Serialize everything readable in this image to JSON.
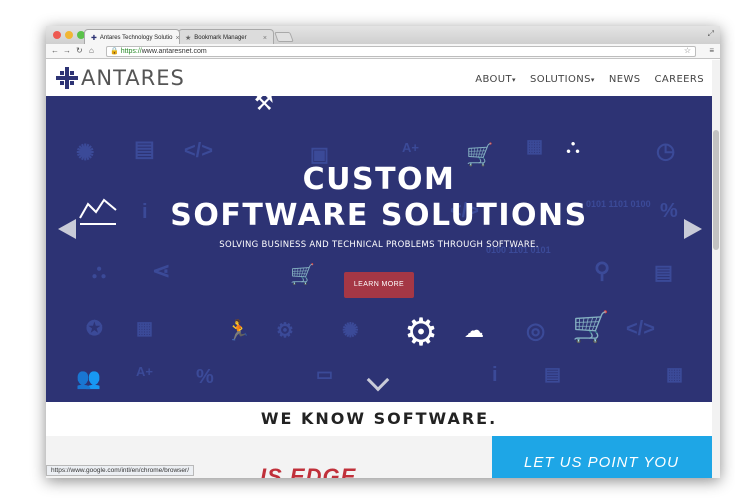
{
  "browser": {
    "tabs": [
      {
        "title": "Antares Technology Solutio"
      },
      {
        "title": "Bookmark Manager"
      }
    ],
    "url_scheme": "https://",
    "url_rest": "www.antaresnet.com",
    "status_url": "https://www.google.com/intl/en/chrome/browser/"
  },
  "site": {
    "logo_text": "ANTARES",
    "nav": [
      {
        "label": "ABOUT"
      },
      {
        "label": "SOLUTIONS"
      },
      {
        "label": "NEWS"
      },
      {
        "label": "CAREERS"
      }
    ],
    "hero": {
      "headline_1": "CUSTOM",
      "headline_2": "SOFTWARE SOLUTIONS",
      "tagline": "SOLVING BUSINESS AND TECHNICAL PROBLEMS THROUGH SOFTWARE.",
      "cta": "LEARN MORE",
      "bg_texts": [
        "</>",
        "</>",
        "</>",
        "0100 1101 0101",
        "0101 1101 0100",
        "i",
        "i",
        "%",
        "%",
        "A+",
        "A+"
      ]
    },
    "tagline_band": "WE KNOW SOFTWARE.",
    "below_left_text": "IS EDGE",
    "below_right_text": "LET US POINT YOU"
  },
  "colors": {
    "hero_bg": "#2d3374",
    "cta_bg": "#a53745",
    "accent_blue": "#1ea6e6"
  }
}
